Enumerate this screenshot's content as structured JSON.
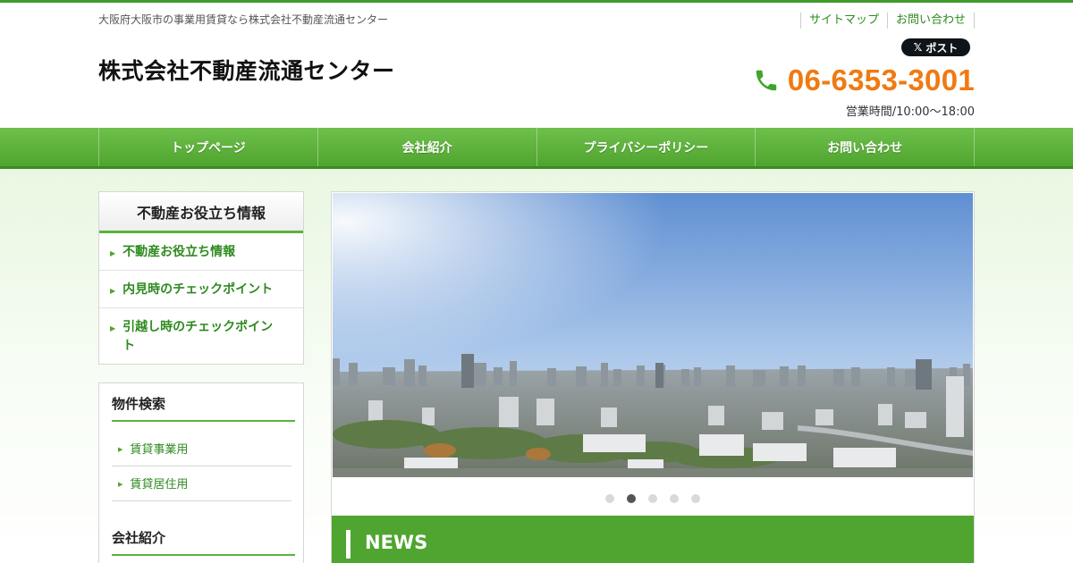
{
  "header": {
    "tagline": "大阪府大阪市の事業用賃貸なら株式会社不動産流通センター",
    "company_name": "株式会社不動産流通センター",
    "util_links": [
      "サイトマップ",
      "お問い合わせ"
    ],
    "x_button": {
      "icon": "x-logo-icon",
      "label": "ポスト"
    },
    "phone": {
      "icon": "phone-icon",
      "number": "06-6353-3001"
    },
    "hours": "営業時間/10:00～18:00"
  },
  "nav": {
    "items": [
      "トップページ",
      "会社紹介",
      "プライバシーポリシー",
      "お問い合わせ"
    ]
  },
  "sidebar": {
    "box1": {
      "title": "不動産お役立ち情報",
      "items": [
        "不動産お役立ち情報",
        "内見時のチェックポイント",
        "引越し時のチェックポイント"
      ]
    },
    "box2": {
      "search_title": "物件検索",
      "search_items": [
        "賃貸事業用",
        "賃貸居住用"
      ],
      "company_title": "会社紹介"
    }
  },
  "main": {
    "slider": {
      "image": "city-skyline-photo",
      "slide_count": 5,
      "active_index": 1
    },
    "news_title": "NEWS"
  },
  "colors": {
    "accent_green": "#4fa52f",
    "link_green": "#2f8a20",
    "phone_orange": "#f07a12"
  }
}
